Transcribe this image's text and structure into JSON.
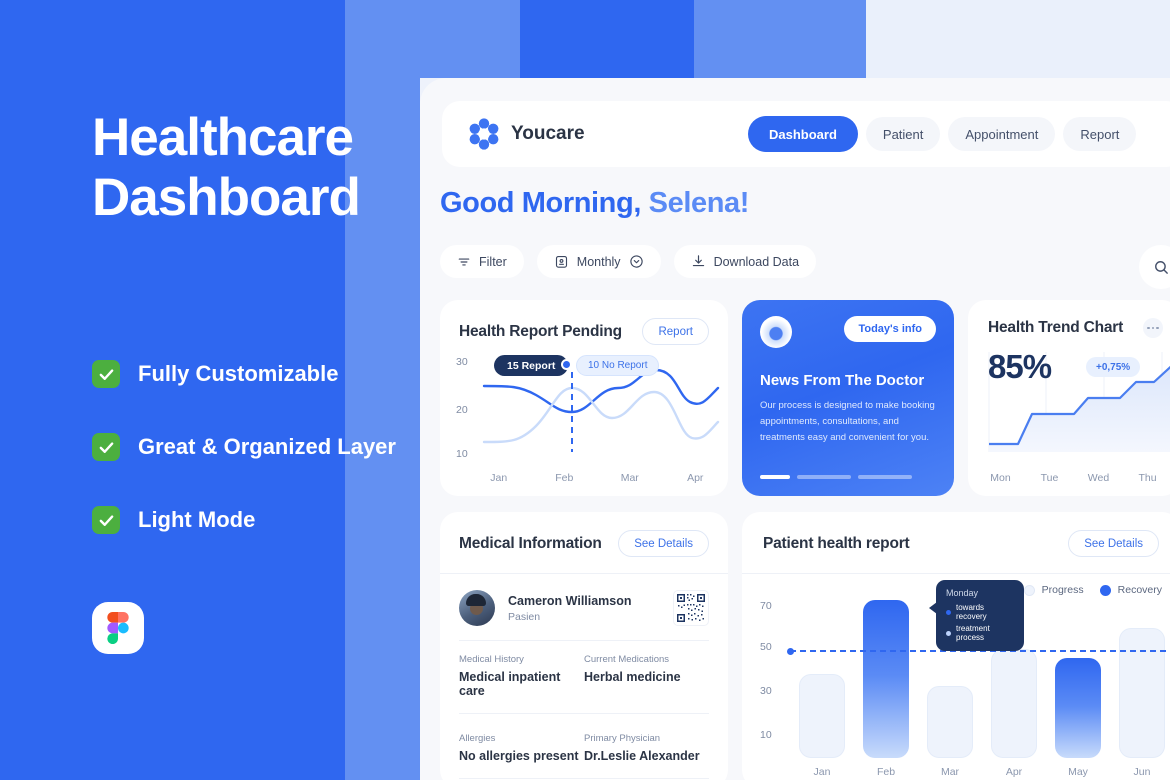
{
  "hero": {
    "title_line1": "Healthcare",
    "title_line2": "Dashboard",
    "features": [
      {
        "label": "Fully Customizable"
      },
      {
        "label": "Great & Organized Layer"
      },
      {
        "label": "Light Mode"
      }
    ],
    "badge_icon": "figma-icon"
  },
  "nav": {
    "brand": "Youcare",
    "logo_icon": "youcare-flower-logo-icon",
    "tabs": [
      {
        "label": "Dashboard",
        "active": true
      },
      {
        "label": "Patient",
        "active": false
      },
      {
        "label": "Appointment",
        "active": false
      },
      {
        "label": "Report",
        "active": false
      }
    ]
  },
  "greeting": {
    "prefix": "Good Morning,",
    "name": "Selena!"
  },
  "filterbar": {
    "filter_label": "Filter",
    "period_label": "Monthly",
    "download_label": "Download Data",
    "search_icon": "search-icon"
  },
  "cards": {
    "health_report_pending": {
      "title": "Health Report Pending",
      "action": "Report",
      "chip_primary": "15 Report",
      "chip_secondary": "10 No Report"
    },
    "news": {
      "badge": "Today's info",
      "title": "News From The Doctor",
      "body": "Our process is designed to make booking appointments, consultations, and treatments easy and convenient for you."
    },
    "health_trend": {
      "title": "Health Trend Chart",
      "value": "85%",
      "delta": "+0,75%",
      "more_icon": "more-horizontal-icon"
    },
    "medical_information": {
      "title": "Medical Information",
      "action": "See Details",
      "patient_name": "Cameron Williamson",
      "patient_role": "Pasien",
      "qr_icon": "qr-code-icon",
      "fields": [
        {
          "label": "Medical History",
          "value": "Medical inpatient care"
        },
        {
          "label": "Current Medications",
          "value": "Herbal medicine"
        },
        {
          "label": "Allergies",
          "value": "No allergies present"
        },
        {
          "label": "Primary Physician",
          "value": "Dr.Leslie Alexander"
        }
      ]
    },
    "patient_health_report": {
      "title": "Patient health report",
      "action": "See Details",
      "tooltip": {
        "title": "Monday",
        "lines": [
          {
            "text": "towards recovery",
            "color": "#2f67f0"
          },
          {
            "text": "treatment process",
            "color": "#bcd2fb"
          }
        ]
      },
      "legend": [
        {
          "label": "Progress",
          "color": "#e4ecf9"
        },
        {
          "label": "Recovery",
          "color": "#2f67f0"
        }
      ]
    }
  },
  "colors": {
    "brand_blue": "#2f67f0",
    "light_blue": "#6390f2",
    "navy": "#1d3461",
    "green": "#4caf3f",
    "page_bg": "#eef2fb",
    "panel_bg": "#f7f8fb"
  },
  "chart_data": [
    {
      "type": "line",
      "title": "Health Report Pending",
      "xlabel": "",
      "ylabel": "",
      "categories": [
        "Jan",
        "Feb",
        "Mar",
        "Apr"
      ],
      "ytick_labels": [
        "30",
        "20",
        "10"
      ],
      "ylim": [
        10,
        30
      ],
      "grid": false,
      "legend": "none",
      "annotations": [
        "15 Report",
        "10 No Report"
      ],
      "series": [
        {
          "name": "Report",
          "color": "#2f67f0",
          "values": [
            18.5,
            14.5,
            22,
            17.5,
            23.5
          ]
        },
        {
          "name": "No Report",
          "color": "#bcd2fb",
          "values": [
            11.5,
            19.5,
            14,
            20,
            15
          ]
        }
      ]
    },
    {
      "type": "area",
      "title": "Health Trend Chart",
      "categories": [
        "Mon",
        "Tue",
        "Wed",
        "Thu"
      ],
      "xlabel": "",
      "ylabel": "",
      "grid": true,
      "legend": "none",
      "values": [
        12,
        46,
        62,
        100
      ],
      "headline_value": "85%",
      "delta": "+0,75%"
    },
    {
      "type": "bar",
      "title": "Patient health report",
      "categories": [
        "Jan",
        "Feb",
        "Mar",
        "Apr",
        "May",
        "Jun"
      ],
      "ytick_labels": [
        "70",
        "50",
        "30",
        "10"
      ],
      "ylim": [
        10,
        70
      ],
      "xlabel": "",
      "ylabel": "",
      "grid": false,
      "legend": "top-right",
      "threshold_line": 50,
      "series": [
        {
          "name": "Progress",
          "color": "#e4ecf9",
          "values": [
            38,
            null,
            34,
            48,
            null,
            57
          ]
        },
        {
          "name": "Recovery",
          "color": "#2f67f0",
          "values": [
            null,
            73,
            null,
            null,
            45,
            null
          ]
        }
      ]
    }
  ]
}
